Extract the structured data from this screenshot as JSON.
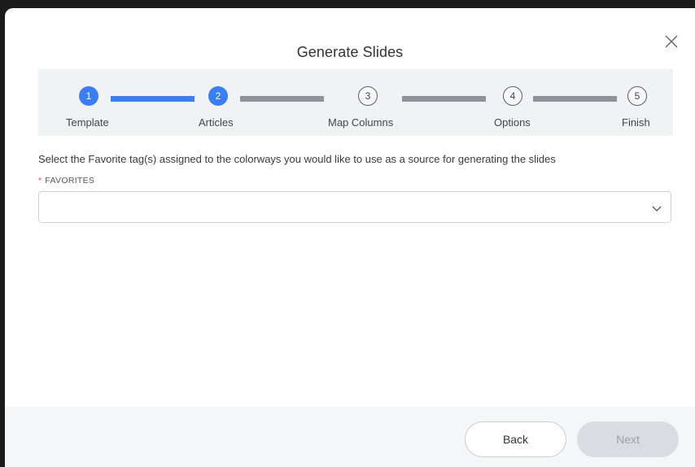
{
  "dialog": {
    "title": "Generate Slides"
  },
  "stepper": {
    "steps": [
      {
        "number": "1",
        "label": "Template",
        "state": "completed"
      },
      {
        "number": "2",
        "label": "Articles",
        "state": "current"
      },
      {
        "number": "3",
        "label": "Map Columns",
        "state": "pending"
      },
      {
        "number": "4",
        "label": "Options",
        "state": "pending"
      },
      {
        "number": "5",
        "label": "Finish",
        "state": "pending"
      }
    ]
  },
  "form": {
    "instruction": "Select the Favorite tag(s) assigned to the colorways you would like to use as a source for generating the slides",
    "favorites": {
      "required_mark": "*",
      "label": "FAVORITES",
      "value": ""
    }
  },
  "footer": {
    "back_label": "Back",
    "next_label": "Next"
  },
  "colors": {
    "accent": "#3a7ef2",
    "pending": "#8f9299",
    "required": "#e44444"
  }
}
